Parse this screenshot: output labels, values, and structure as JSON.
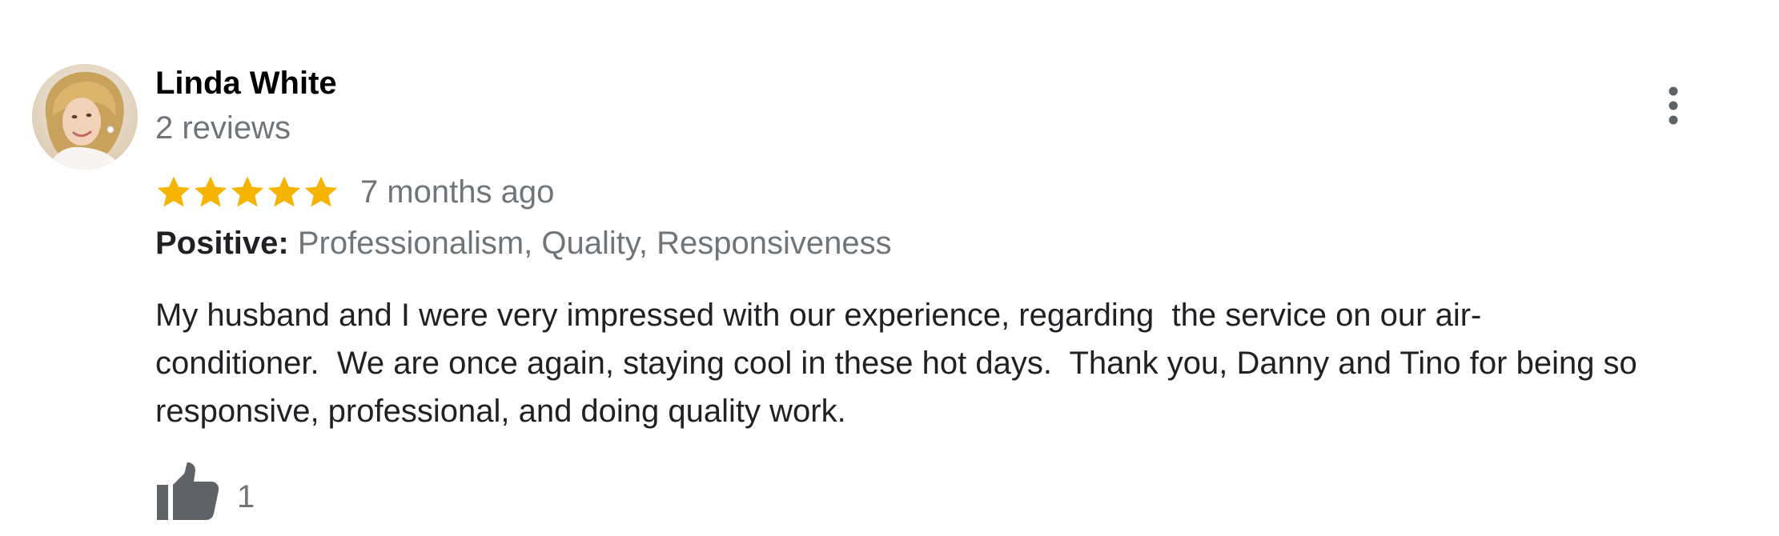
{
  "review": {
    "reviewer_name": "Linda White",
    "review_count": "2 reviews",
    "rating": 5,
    "rating_max": 5,
    "time": "7 months ago",
    "positive_label": "Positive:",
    "positive_values": "Professionalism, Quality, Responsiveness",
    "text_lines": [
      "My husband and I were very impressed with our experience, regarding  the service on our air-",
      "conditioner.  We are once again, staying cool in these hot days.  Thank you, Danny and Tino for being so",
      "responsive, professional, and doing quality work."
    ],
    "like_count": "1"
  },
  "icons": {
    "star": "star-icon",
    "more": "more-vert-icon",
    "like": "thumbs-up-icon"
  },
  "colors": {
    "star": "#f4b400",
    "muted_text": "#70757a",
    "icon_gray": "#5f6368"
  }
}
